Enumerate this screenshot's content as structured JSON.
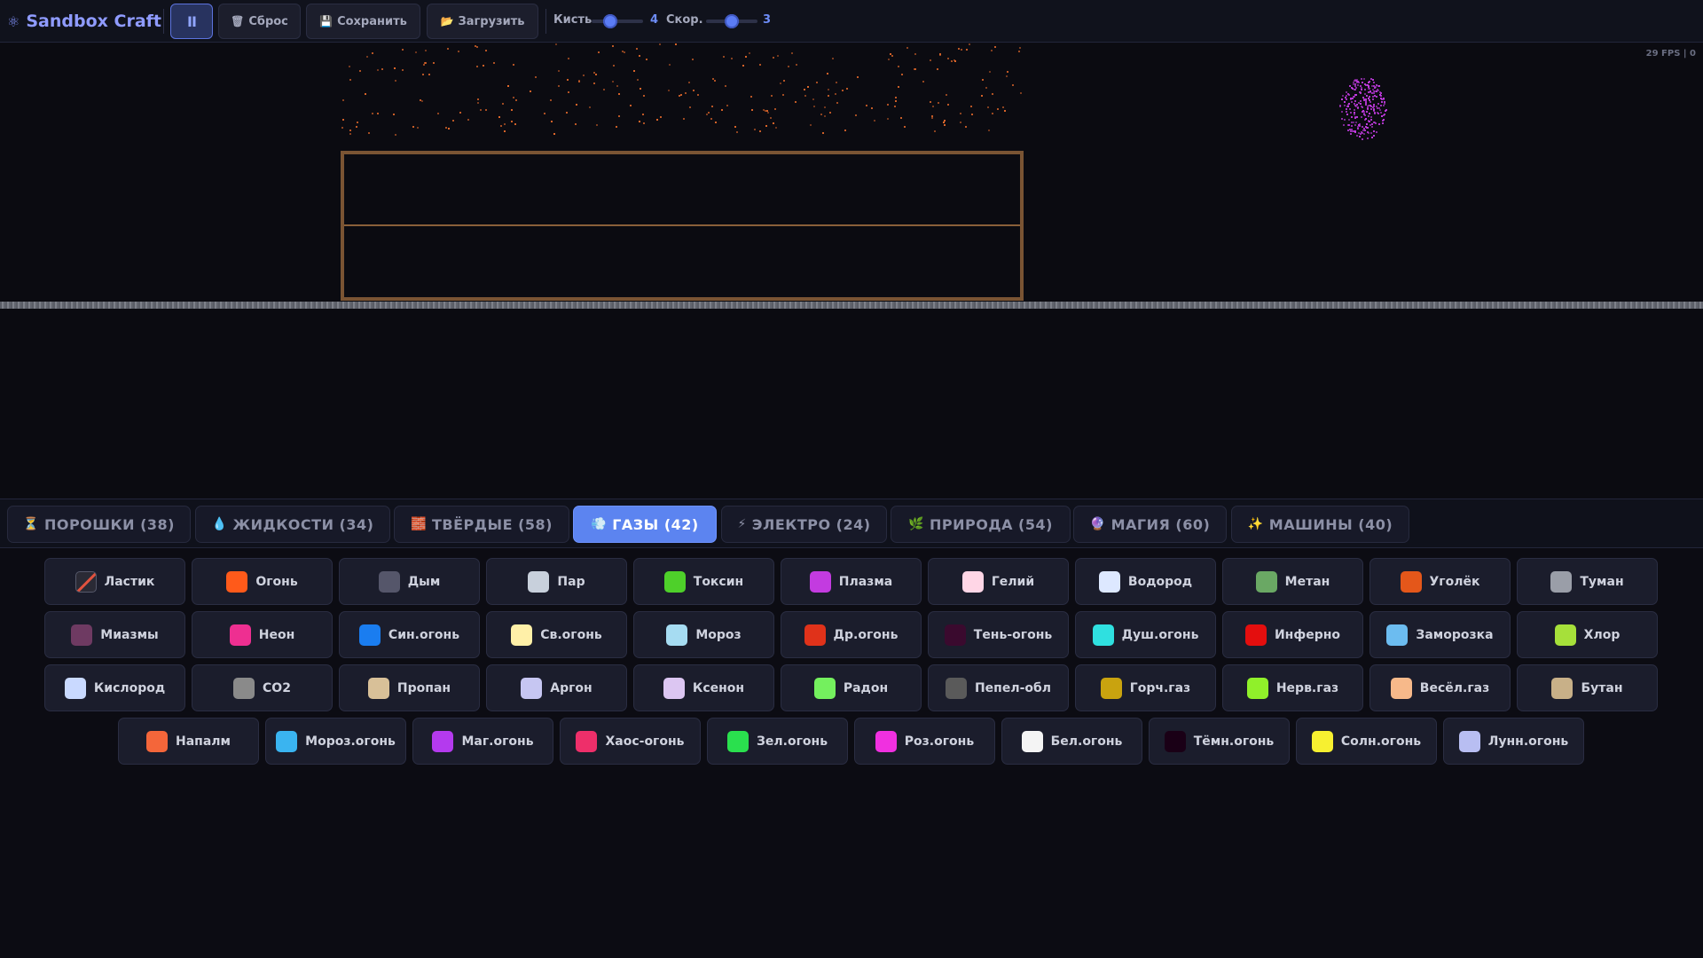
{
  "app": {
    "title": "Sandbox Craft",
    "icon": "atom-icon"
  },
  "toolbar": {
    "pause_label": "II",
    "reset_label": "Сброс",
    "reset_icon": "🗑",
    "save_label": "Сохранить",
    "save_icon": "💾",
    "load_label": "Загрузить",
    "load_icon": "📂",
    "brush_label": "Кисть",
    "brush_value": "4",
    "brush_fraction": 0.3,
    "speed_label": "Скор.",
    "speed_value": "3",
    "speed_fraction": 0.5
  },
  "canvas": {
    "fps_text": "29 FPS | 0",
    "colors": {
      "embers": "#e0672a",
      "plasma": "#c13be0",
      "container": "#7a5433",
      "floor": "#6c6f78"
    }
  },
  "tabs": [
    {
      "icon": "⏳",
      "label": "ПОРОШКИ (38)",
      "active": false
    },
    {
      "icon": "💧",
      "label": "ЖИДКОСТИ (34)",
      "active": false
    },
    {
      "icon": "🧱",
      "label": "ТВЁРДЫЕ (58)",
      "active": false
    },
    {
      "icon": "💨",
      "label": "ГАЗЫ (42)",
      "active": true
    },
    {
      "icon": "⚡",
      "label": "ЭЛЕКТРО (24)",
      "active": false
    },
    {
      "icon": "🌿",
      "label": "ПРИРОДА (54)",
      "active": false
    },
    {
      "icon": "🔮",
      "label": "МАГИЯ (60)",
      "active": false
    },
    {
      "icon": "✨",
      "label": "МАШИНЫ (40)",
      "active": false
    }
  ],
  "elements": [
    [
      {
        "label": "Ластик",
        "color": "#2a2a35",
        "eraser": true
      },
      {
        "label": "Огонь",
        "color": "#ff5a1a"
      },
      {
        "label": "Дым",
        "color": "#55566a"
      },
      {
        "label": "Пар",
        "color": "#c8d0dc"
      },
      {
        "label": "Токсин",
        "color": "#4ed02a"
      },
      {
        "label": "Плазма",
        "color": "#c33be0"
      },
      {
        "label": "Гелий",
        "color": "#ffd6e6"
      },
      {
        "label": "Водород",
        "color": "#dde8ff"
      },
      {
        "label": "Метан",
        "color": "#6aa864"
      },
      {
        "label": "Уголёк",
        "color": "#e4571a"
      },
      {
        "label": "Туман",
        "color": "#9a9ea8"
      }
    ],
    [
      {
        "label": "Миазмы",
        "color": "#6e3a62"
      },
      {
        "label": "Неон",
        "color": "#ee2f91"
      },
      {
        "label": "Син.огонь",
        "color": "#1a7df0"
      },
      {
        "label": "Св.огонь",
        "color": "#fff0a8"
      },
      {
        "label": "Мороз",
        "color": "#a6dcf2"
      },
      {
        "label": "Др.огонь",
        "color": "#e0321a"
      },
      {
        "label": "Тень-огонь",
        "color": "#3a0a2e"
      },
      {
        "label": "Душ.огонь",
        "color": "#2fe0e0"
      },
      {
        "label": "Инферно",
        "color": "#e40e0e"
      },
      {
        "label": "Заморозка",
        "color": "#6cbcf0"
      },
      {
        "label": "Хлор",
        "color": "#a6e03a"
      }
    ],
    [
      {
        "label": "Кислород",
        "color": "#c9d9ff"
      },
      {
        "label": "CO2",
        "color": "#8a8a8a"
      },
      {
        "label": "Пропан",
        "color": "#d8c098"
      },
      {
        "label": "Аргон",
        "color": "#c6c6f2"
      },
      {
        "label": "Ксенон",
        "color": "#dcc6f2"
      },
      {
        "label": "Радон",
        "color": "#74f05e"
      },
      {
        "label": "Пепел-обл",
        "color": "#5a5a5a"
      },
      {
        "label": "Горч.газ",
        "color": "#c9a30f"
      },
      {
        "label": "Нерв.газ",
        "color": "#90f02a"
      },
      {
        "label": "Весёл.газ",
        "color": "#f7b98a"
      },
      {
        "label": "Бутан",
        "color": "#c8b088"
      }
    ],
    [
      {
        "label": "Напалм",
        "color": "#f4663a"
      },
      {
        "label": "Мороз.огонь",
        "color": "#3ab4f0"
      },
      {
        "label": "Маг.огонь",
        "color": "#b43aee"
      },
      {
        "label": "Хаос-огонь",
        "color": "#ee2f6a"
      },
      {
        "label": "Зел.огонь",
        "color": "#2ae04e"
      },
      {
        "label": "Роз.огонь",
        "color": "#f030e0"
      },
      {
        "label": "Бел.огонь",
        "color": "#f4f4f4"
      },
      {
        "label": "Тёмн.огонь",
        "color": "#1a0016"
      },
      {
        "label": "Солн.огонь",
        "color": "#f7f030"
      },
      {
        "label": "Лунн.огонь",
        "color": "#b8bef2"
      }
    ]
  ]
}
